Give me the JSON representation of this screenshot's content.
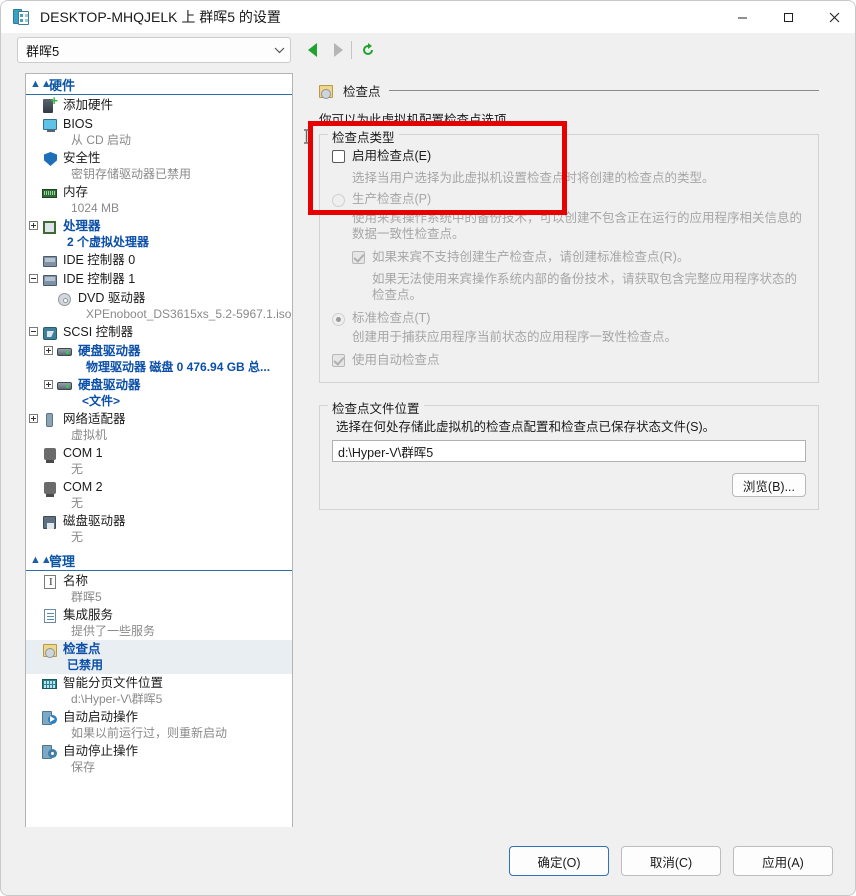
{
  "window": {
    "title": "DESKTOP-MHQJELK 上 群晖5 的设置",
    "icon": "vm-settings-icon",
    "controls": {
      "minimize": "minimize-icon",
      "maximize": "maximize-icon",
      "close": "close-icon"
    }
  },
  "toolbar": {
    "vm_selected": "群晖5",
    "back_label": "back-arrow-icon",
    "forward_label": "forward-arrow-icon",
    "refresh_label": "refresh-icon"
  },
  "sidebar": {
    "groups": [
      {
        "label": "硬件",
        "items": [
          {
            "label": "添加硬件",
            "sub": "",
            "icon": "add-hardware-icon",
            "expander": "",
            "blue": false,
            "indent": 1
          },
          {
            "label": "BIOS",
            "sub": "从 CD 启动",
            "icon": "bios-icon",
            "expander": "",
            "blue": false,
            "indent": 1
          },
          {
            "label": "安全性",
            "sub": "密钥存储驱动器已禁用",
            "icon": "security-shield-icon",
            "expander": "",
            "blue": false,
            "indent": 1
          },
          {
            "label": "内存",
            "sub": "1024 MB",
            "icon": "memory-icon",
            "expander": "",
            "blue": false,
            "indent": 1
          },
          {
            "label": "处理器",
            "sub": "2 个虚拟处理器",
            "icon": "processor-icon",
            "expander": "plus",
            "blue": true,
            "indent": 0
          },
          {
            "label": "IDE 控制器 0",
            "sub": "",
            "icon": "ide-controller-icon",
            "expander": "",
            "blue": false,
            "indent": 1
          },
          {
            "label": "IDE 控制器 1",
            "sub": "",
            "icon": "ide-controller-icon",
            "expander": "minus",
            "blue": false,
            "indent": 0
          },
          {
            "label": "DVD 驱动器",
            "sub": "XPEnoboot_DS3615xs_5.2-5967.1.iso",
            "icon": "dvd-drive-icon",
            "expander": "",
            "blue": false,
            "indent": 2
          },
          {
            "label": "SCSI 控制器",
            "sub": "",
            "icon": "scsi-controller-icon",
            "expander": "minus",
            "blue": false,
            "indent": 0
          },
          {
            "label": "硬盘驱动器",
            "sub": "物理驱动器 磁盘 0 476.94 GB 总...",
            "icon": "hard-drive-icon",
            "expander": "plus",
            "blue": true,
            "indent": 1
          },
          {
            "label": "硬盘驱动器",
            "sub": "<文件>",
            "icon": "hard-drive-icon",
            "expander": "plus",
            "blue": true,
            "indent": 1
          },
          {
            "label": "网络适配器",
            "sub": "虚拟机",
            "icon": "network-adapter-icon",
            "expander": "plus",
            "blue": false,
            "indent": 0
          },
          {
            "label": "COM 1",
            "sub": "无",
            "icon": "com-port-icon",
            "expander": "",
            "blue": false,
            "indent": 1
          },
          {
            "label": "COM 2",
            "sub": "无",
            "icon": "com-port-icon",
            "expander": "",
            "blue": false,
            "indent": 1
          },
          {
            "label": "磁盘驱动器",
            "sub": "无",
            "icon": "floppy-drive-icon",
            "expander": "",
            "blue": false,
            "indent": 1
          }
        ]
      },
      {
        "label": "管理",
        "items": [
          {
            "label": "名称",
            "sub": "群晖5",
            "icon": "name-icon",
            "expander": "",
            "blue": false,
            "indent": 1
          },
          {
            "label": "集成服务",
            "sub": "提供了一些服务",
            "icon": "integration-services-icon",
            "expander": "",
            "blue": false,
            "indent": 1
          },
          {
            "label": "检查点",
            "sub": "已禁用",
            "icon": "checkpoints-icon",
            "expander": "",
            "blue": true,
            "indent": 1,
            "selected": true
          },
          {
            "label": "智能分页文件位置",
            "sub": "d:\\Hyper-V\\群晖5",
            "icon": "smart-paging-icon",
            "expander": "",
            "blue": false,
            "indent": 1
          },
          {
            "label": "自动启动操作",
            "sub": "如果以前运行过，则重新启动",
            "icon": "auto-start-icon",
            "expander": "",
            "blue": false,
            "indent": 1
          },
          {
            "label": "自动停止操作",
            "sub": "保存",
            "icon": "auto-stop-icon",
            "expander": "",
            "blue": false,
            "indent": 1
          }
        ]
      }
    ]
  },
  "main": {
    "section_title": "检查点",
    "section_icon": "checkpoints-icon",
    "description": "你可以为此虚拟机配置检查点选项。",
    "checkpoint_type": {
      "legend": "检查点类型",
      "enable_checkbox": {
        "label": "启用检查点(E)",
        "checked": false,
        "enabled": true
      },
      "hint": "选择当用户选择为此虚拟机设置检查点时将创建的检查点的类型。",
      "production_radio": {
        "label": "生产检查点(P)",
        "selected": false,
        "enabled": false
      },
      "production_desc": "使用来宾操作系统中的备份技术，可以创建不包含正在运行的应用程序相关信息的数据一致性检查点。",
      "fallback_checkbox": {
        "label": "如果来宾不支持创建生产检查点，请创建标准检查点(R)。",
        "checked": true,
        "enabled": false
      },
      "fallback_desc": "如果无法使用来宾操作系统内部的备份技术，请获取包含完整应用程序状态的检查点。",
      "standard_radio": {
        "label": "标准检查点(T)",
        "selected": true,
        "enabled": false
      },
      "standard_desc": "创建用于捕获应用程序当前状态的应用程序一致性检查点。",
      "auto_checkbox": {
        "label": "使用自动检查点",
        "checked": true,
        "enabled": false
      }
    },
    "file_location": {
      "legend": "检查点文件位置",
      "hint": "选择在何处存储此虚拟机的检查点配置和检查点已保存状态文件(S)。",
      "path": "d:\\Hyper-V\\群晖5",
      "browse_label": "浏览(B)..."
    }
  },
  "footer": {
    "ok": "确定(O)",
    "cancel": "取消(C)",
    "apply": "应用(A)"
  },
  "annotation": {
    "color": "#e60000"
  }
}
